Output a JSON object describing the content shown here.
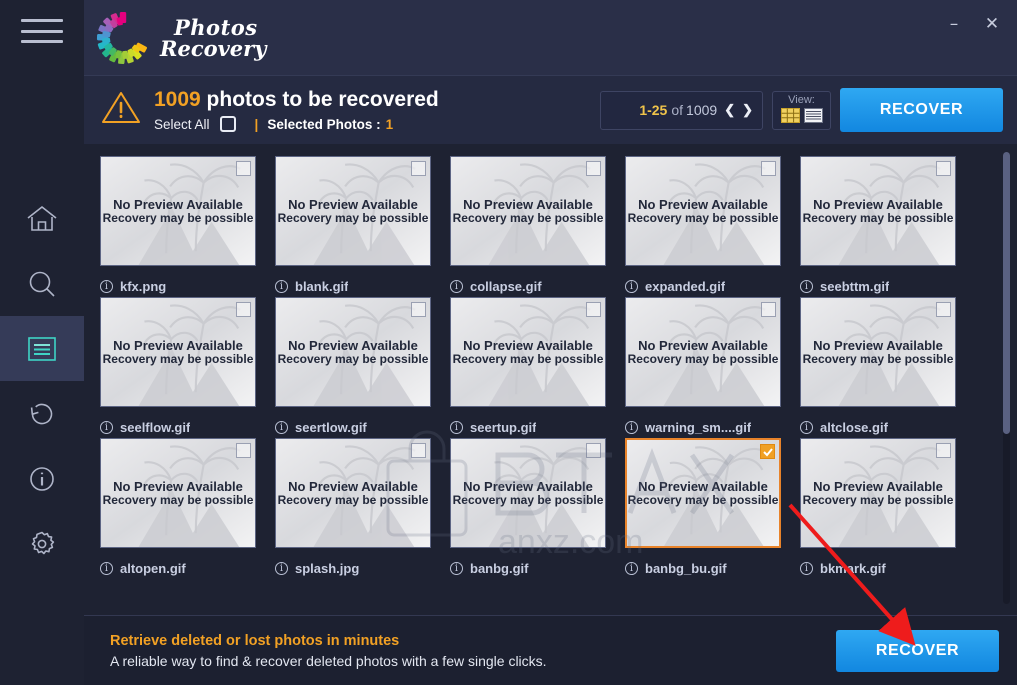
{
  "app": {
    "logo_line1": "Photos",
    "logo_line2": "Recovery",
    "logo_icon": "photos-recovery-color-wheel-logo"
  },
  "window_controls": {
    "minimize_label": "–",
    "minimize_icon": "minimize-icon",
    "close_label": "✕",
    "close_icon": "close-icon"
  },
  "sidebar": {
    "menu_icon": "hamburger-menu-icon",
    "items": [
      {
        "name": "home",
        "icon": "home-icon",
        "active": false
      },
      {
        "name": "search",
        "icon": "search-icon",
        "active": false
      },
      {
        "name": "list",
        "icon": "list-icon",
        "active": true
      },
      {
        "name": "restore",
        "icon": "restore-icon",
        "active": false
      },
      {
        "name": "info",
        "icon": "info-icon",
        "active": false
      },
      {
        "name": "settings",
        "icon": "gear-icon",
        "active": false
      }
    ]
  },
  "header": {
    "warning_icon": "warning-triangle-icon",
    "count": "1009",
    "title_rest": " photos to be recovered",
    "select_all_label": "Select All",
    "select_all_checked": false,
    "divider": "|",
    "selected_label": "Selected Photos :",
    "selected_value": "1",
    "pagination": {
      "range": "1-25",
      "of": "of",
      "total": "1009",
      "prev_icon": "chevron-left-icon",
      "prev_label": "❮",
      "next_icon": "chevron-right-icon",
      "next_label": "❯"
    },
    "view": {
      "label": "View:",
      "grid_icon": "grid-view-icon",
      "list_icon": "list-view-icon",
      "active": "grid"
    },
    "recover_label": "RECOVER"
  },
  "grid": {
    "no_preview_line1": "No Preview Available",
    "no_preview_line2": "Recovery may be possible",
    "info_glyph": "i",
    "check_glyph": "✓",
    "items": [
      {
        "filename": "kfx.png",
        "selected": false
      },
      {
        "filename": "blank.gif",
        "selected": false
      },
      {
        "filename": "collapse.gif",
        "selected": false
      },
      {
        "filename": "expanded.gif",
        "selected": false
      },
      {
        "filename": "seebttm.gif",
        "selected": false
      },
      {
        "filename": "seelflow.gif",
        "selected": false
      },
      {
        "filename": "seertlow.gif",
        "selected": false
      },
      {
        "filename": "seertup.gif",
        "selected": false
      },
      {
        "filename": "warning_sm....gif",
        "selected": false
      },
      {
        "filename": "altclose.gif",
        "selected": false
      },
      {
        "filename": "altopen.gif",
        "selected": false
      },
      {
        "filename": "splash.jpg",
        "selected": false
      },
      {
        "filename": "banbg.gif",
        "selected": false
      },
      {
        "filename": "banbg_bu.gif",
        "selected": true
      },
      {
        "filename": "bkmark.gif",
        "selected": false
      }
    ]
  },
  "watermark": {
    "text": "anxz.com",
    "icon": "lock-watermark-icon"
  },
  "footer": {
    "headline": "Retrieve deleted or lost photos in minutes",
    "subline": "A reliable way to find & recover deleted photos with a few single clicks.",
    "recover_label": "RECOVER"
  },
  "annotation": {
    "arrow_icon": "red-arrow-annotation",
    "color": "#ee1c1c"
  },
  "colors": {
    "accent_orange": "#f2a124",
    "accent_blue": "#1d93e8",
    "selected_border": "#e8832a",
    "panel_bg": "#1e2232",
    "header_bg": "#252a41",
    "titlebar_bg": "#2a2f48",
    "sidebar_bg": "#1e2232",
    "active_nav": "#353b58",
    "nav_icon": "#aeb4c8",
    "active_nav_icon": "#3fd4c5"
  }
}
